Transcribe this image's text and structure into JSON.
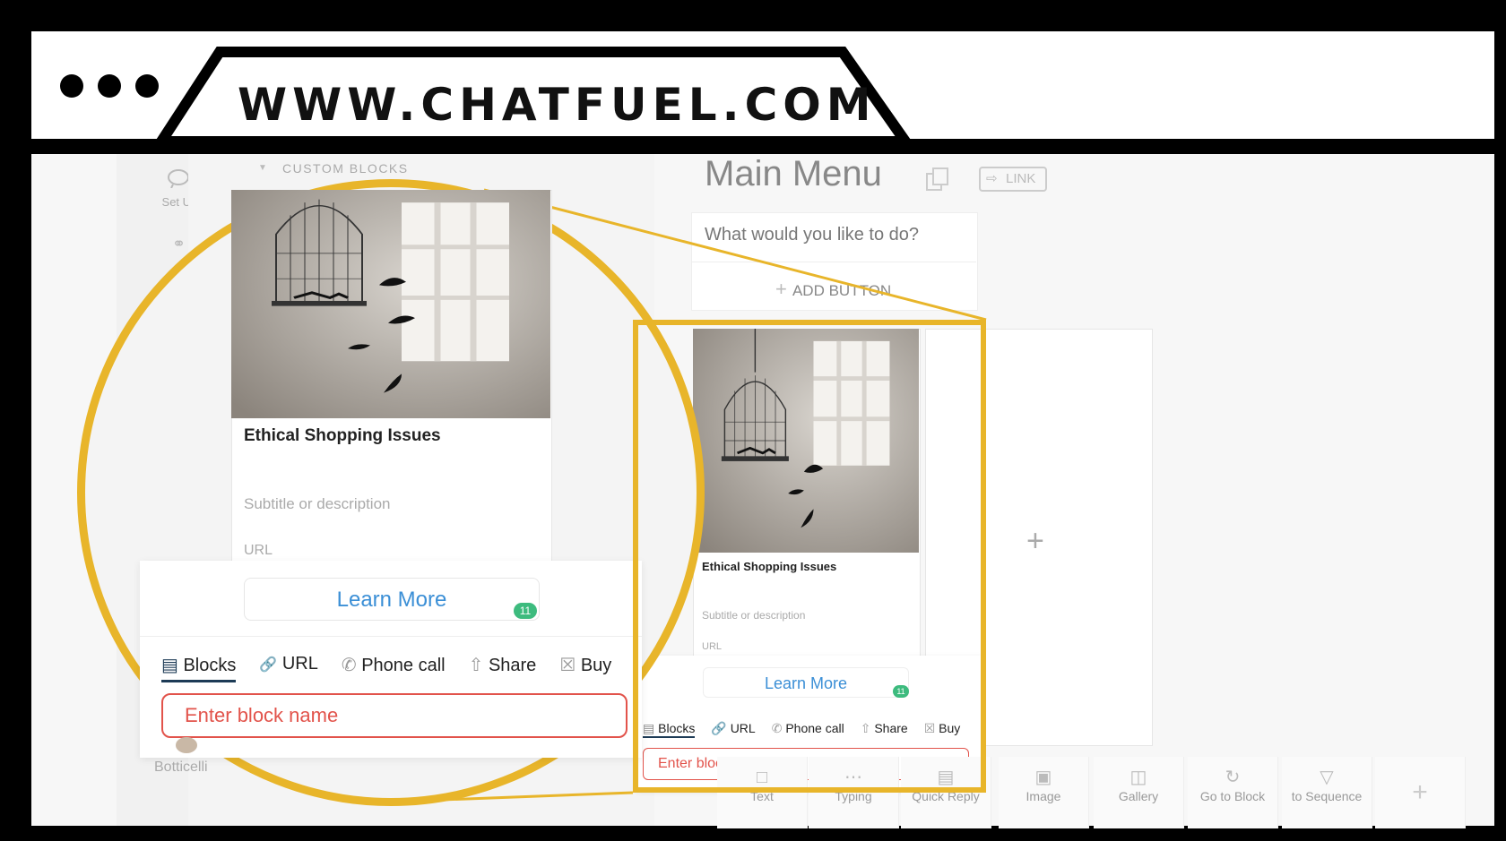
{
  "browser": {
    "url": "WWW.CHATFUEL.COM"
  },
  "sidebar": {
    "items": [
      {
        "label": "Set Up AI",
        "icon": "ai-brain-icon"
      },
      {
        "label": "Botticelli",
        "icon": "avatar"
      }
    ]
  },
  "block_list": {
    "section_label": "CUSTOM BLOCKS"
  },
  "main": {
    "title": "Main Menu",
    "link_label": "LINK",
    "text_card": {
      "message": "What would you like to do?",
      "add_button_label": "ADD BUTTON"
    },
    "gallery_card": {
      "title": "Ethical Shopping Issues",
      "subtitle_placeholder": "Subtitle or description",
      "url_placeholder": "URL",
      "button_label": "Learn More",
      "button_char_count": "11"
    },
    "button_editor": {
      "tabs": [
        {
          "label": "Blocks",
          "icon": "blocks-icon",
          "active": true
        },
        {
          "label": "URL",
          "icon": "link-icon"
        },
        {
          "label": "Phone call",
          "icon": "phone-icon"
        },
        {
          "label": "Share",
          "icon": "share-icon"
        },
        {
          "label": "Buy",
          "icon": "cart-icon"
        }
      ],
      "input_placeholder": "Enter block name"
    },
    "toolbar": [
      {
        "label": "Text",
        "icon": "text-icon"
      },
      {
        "label": "Typing",
        "icon": "typing-icon"
      },
      {
        "label": "Quick Reply",
        "icon": "quick-reply-icon"
      },
      {
        "label": "Image",
        "icon": "image-icon"
      },
      {
        "label": "Gallery",
        "icon": "gallery-icon"
      },
      {
        "label": "Go to Block",
        "icon": "go-to-block-icon"
      },
      {
        "label": "to Sequence",
        "icon": "filter-icon"
      }
    ]
  },
  "colors": {
    "highlight": "#e8b52a",
    "accent_blue": "#3b8fd6",
    "error_red": "#e2534b",
    "badge_green": "#3dbb7e"
  }
}
